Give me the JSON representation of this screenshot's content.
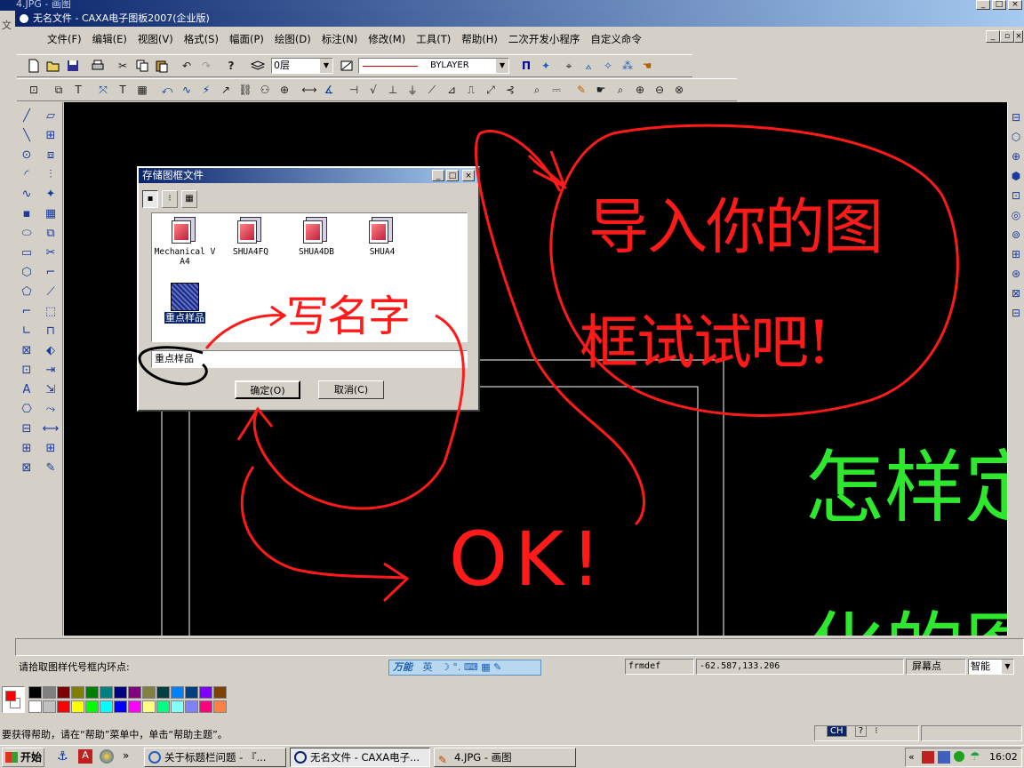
{
  "paint_window": {
    "title": "4.JPG - 画图",
    "menu_hint": "文"
  },
  "caxa_window": {
    "title": "无名文件 - CAXA电子图板2007(企业版)",
    "menu": [
      "文件(F)",
      "编辑(E)",
      "视图(V)",
      "格式(S)",
      "幅面(P)",
      "绘图(D)",
      "标注(N)",
      "修改(M)",
      "工具(T)",
      "帮助(H)",
      "二次开发小程序",
      "自定义命令"
    ],
    "layer_value": "0层",
    "linetype_value": "BYLAYER",
    "prompt": "请拾取图样代号框内环点:",
    "status_fields": {
      "command": "frmdef",
      "coords": "-62.587,133.206",
      "point_mode": "屏幕点",
      "snap_mode": "智能"
    },
    "ime": {
      "name": "万能",
      "mode": "英"
    }
  },
  "dialog": {
    "title": "存储图框文件",
    "files": [
      {
        "name": "Mechanical V A4"
      },
      {
        "name": "SHUA4FQ"
      },
      {
        "name": "SHUA4DB"
      },
      {
        "name": "SHUA4"
      },
      {
        "name": "重点样品",
        "selected": true
      }
    ],
    "filename_value": "重点样品",
    "ok_label": "确定(O)",
    "cancel_label": "取消(C)"
  },
  "annotations": {
    "write_name": "写名字",
    "bubble_line1": "导入你的图",
    "bubble_line2": "框试试吧!",
    "ok": "OK!",
    "green_line1": "怎样定",
    "green_line2": "化的图"
  },
  "paint_statusbar": {
    "help_text": "要获得帮助，请在“帮助”菜单中，单击“帮助主题”。"
  },
  "taskbar": {
    "start_label": "开始",
    "items": [
      "关于标题栏问题 - 『...",
      "无名文件 - CAXA电子...",
      "4.JPG - 画图"
    ],
    "tray_ch": "CH",
    "clock": "16:02"
  },
  "colors": {
    "canvas": "#000000",
    "annotation_red": "#ff1a1a",
    "annotation_green": "#2ee82e",
    "title_blue": "#0a246a"
  },
  "palette": [
    "#000000",
    "#808080",
    "#800000",
    "#808000",
    "#008000",
    "#008080",
    "#000080",
    "#800080",
    "#808040",
    "#004040",
    "#0080ff",
    "#004080",
    "#8000ff",
    "#804000",
    "#ffffff",
    "#c0c0c0",
    "#ff0000",
    "#ffff00",
    "#00ff00",
    "#00ffff",
    "#0000ff",
    "#ff00ff",
    "#ffff80",
    "#00ff80",
    "#80ffff",
    "#8080ff",
    "#ff0080",
    "#ff8040"
  ]
}
